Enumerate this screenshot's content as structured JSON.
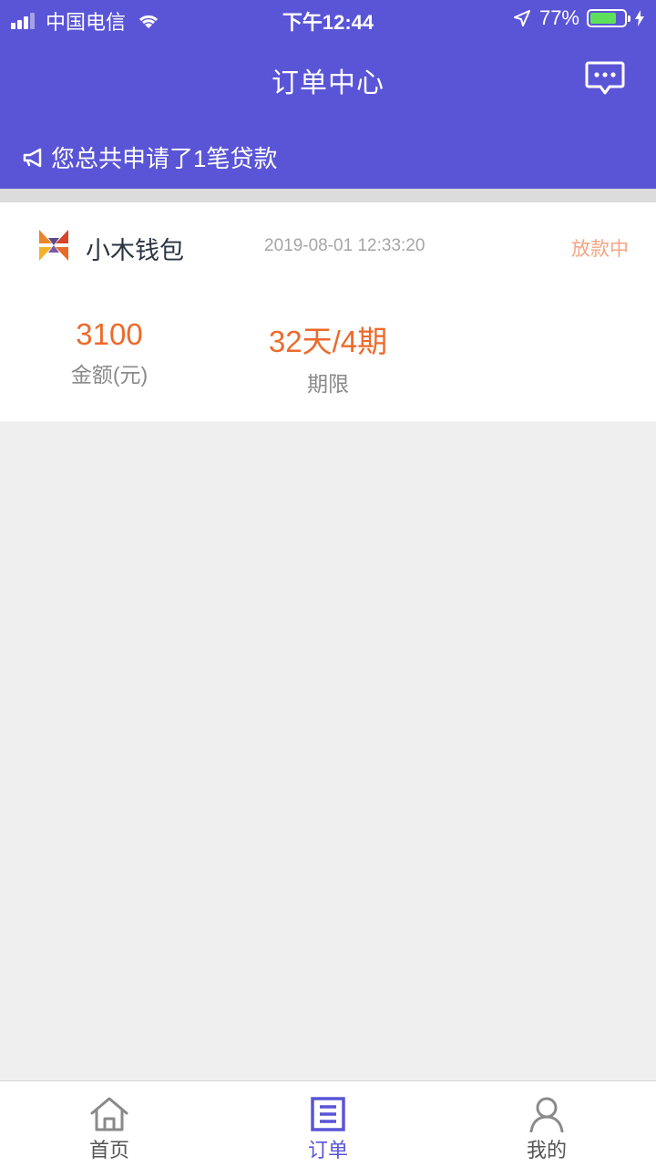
{
  "status_bar": {
    "carrier": "中国电信",
    "time": "下午12:44",
    "battery": "77%",
    "battery_level": 0.77
  },
  "header": {
    "title": "订单中心",
    "notice": "您总共申请了1笔贷款"
  },
  "order": {
    "product_name": "小木钱包",
    "datetime": "2019-08-01 12:33:20",
    "status": "放款中",
    "amount_value": "3100",
    "amount_label": "金额(元)",
    "term_value": "32天/4期",
    "term_label": "期限"
  },
  "tabs": [
    {
      "label": "首页",
      "icon": "home-icon",
      "active": false
    },
    {
      "label": "订单",
      "icon": "order-list-icon",
      "active": true
    },
    {
      "label": "我的",
      "icon": "user-icon",
      "active": false
    }
  ],
  "colors": {
    "brand": "#5a55d6",
    "accent_orange": "#ec6a2b",
    "status_orange": "#f4a583"
  }
}
